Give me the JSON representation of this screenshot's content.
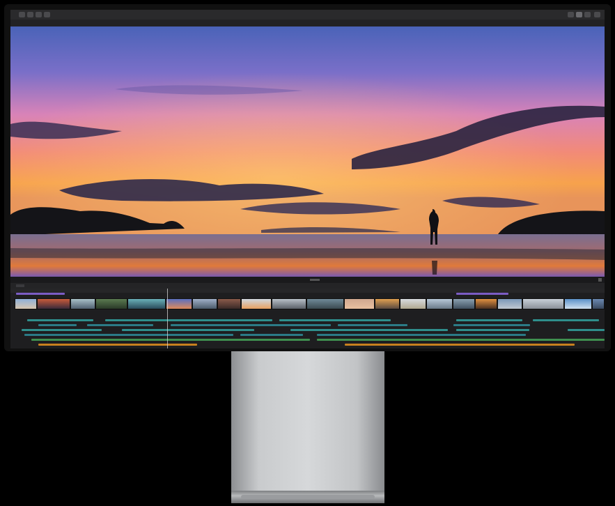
{
  "app": {
    "project_title": "",
    "library_label": "",
    "timeline_title": ""
  },
  "colors": {
    "teal": "#2f8f8c",
    "green": "#3f8f4f",
    "orange": "#c8801e",
    "purple": "#7b5cc4",
    "bezel": "#111111"
  },
  "icons": [
    "library-icon",
    "photos-icon",
    "titles-icon",
    "import-icon",
    "share-icon"
  ]
}
